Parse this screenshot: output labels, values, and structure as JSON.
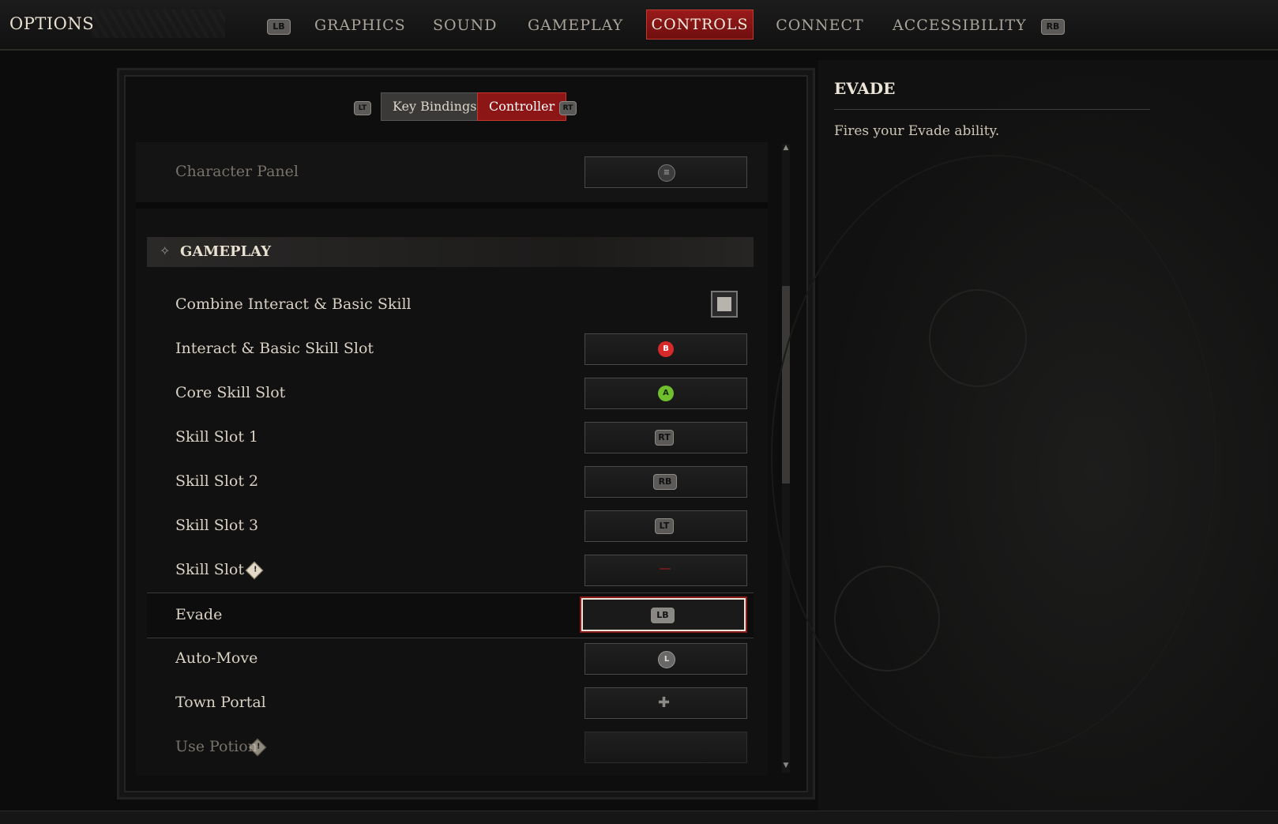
{
  "header": {
    "title": "OPTIONS",
    "prev_glyph": "LB",
    "next_glyph": "RB",
    "tabs": [
      {
        "label": "GRAPHICS"
      },
      {
        "label": "SOUND"
      },
      {
        "label": "GAMEPLAY"
      },
      {
        "label": "CONTROLS",
        "active": true
      },
      {
        "label": "CONNECT"
      },
      {
        "label": "ACCESSIBILITY"
      }
    ]
  },
  "subtabs": {
    "prev_glyph": "LT",
    "next_glyph": "RT",
    "items": [
      {
        "label": "Key Bindings"
      },
      {
        "label": "Controller",
        "active": true
      }
    ]
  },
  "bindings": {
    "character_panel": {
      "label": "Character Panel",
      "icon": "menu-button-icon"
    },
    "section_title": "GAMEPLAY",
    "rows": [
      {
        "label": "Combine Interact & Basic Skill",
        "type": "checkbox",
        "checked": false
      },
      {
        "label": "Interact & Basic Skill Slot",
        "button": "B",
        "color": "#d62a2a"
      },
      {
        "label": "Core Skill Slot",
        "button": "A",
        "color": "#6fbf2e"
      },
      {
        "label": "Skill Slot 1",
        "button": "RT"
      },
      {
        "label": "Skill Slot 2",
        "button": "RB"
      },
      {
        "label": "Skill Slot 3",
        "button": "LT"
      },
      {
        "label": "Skill Slot 4",
        "button": "",
        "warning": true
      },
      {
        "label": "Evade",
        "button": "LB",
        "selected": true
      },
      {
        "label": "Auto-Move",
        "button": "",
        "icon": "left-stick-icon"
      },
      {
        "label": "Town Portal",
        "button": "",
        "icon": "dpad-icon"
      },
      {
        "label": "Use Potion",
        "button": "",
        "warning": true,
        "dim": true
      }
    ]
  },
  "detail": {
    "title": "EVADE",
    "description": "Fires your Evade ability."
  }
}
